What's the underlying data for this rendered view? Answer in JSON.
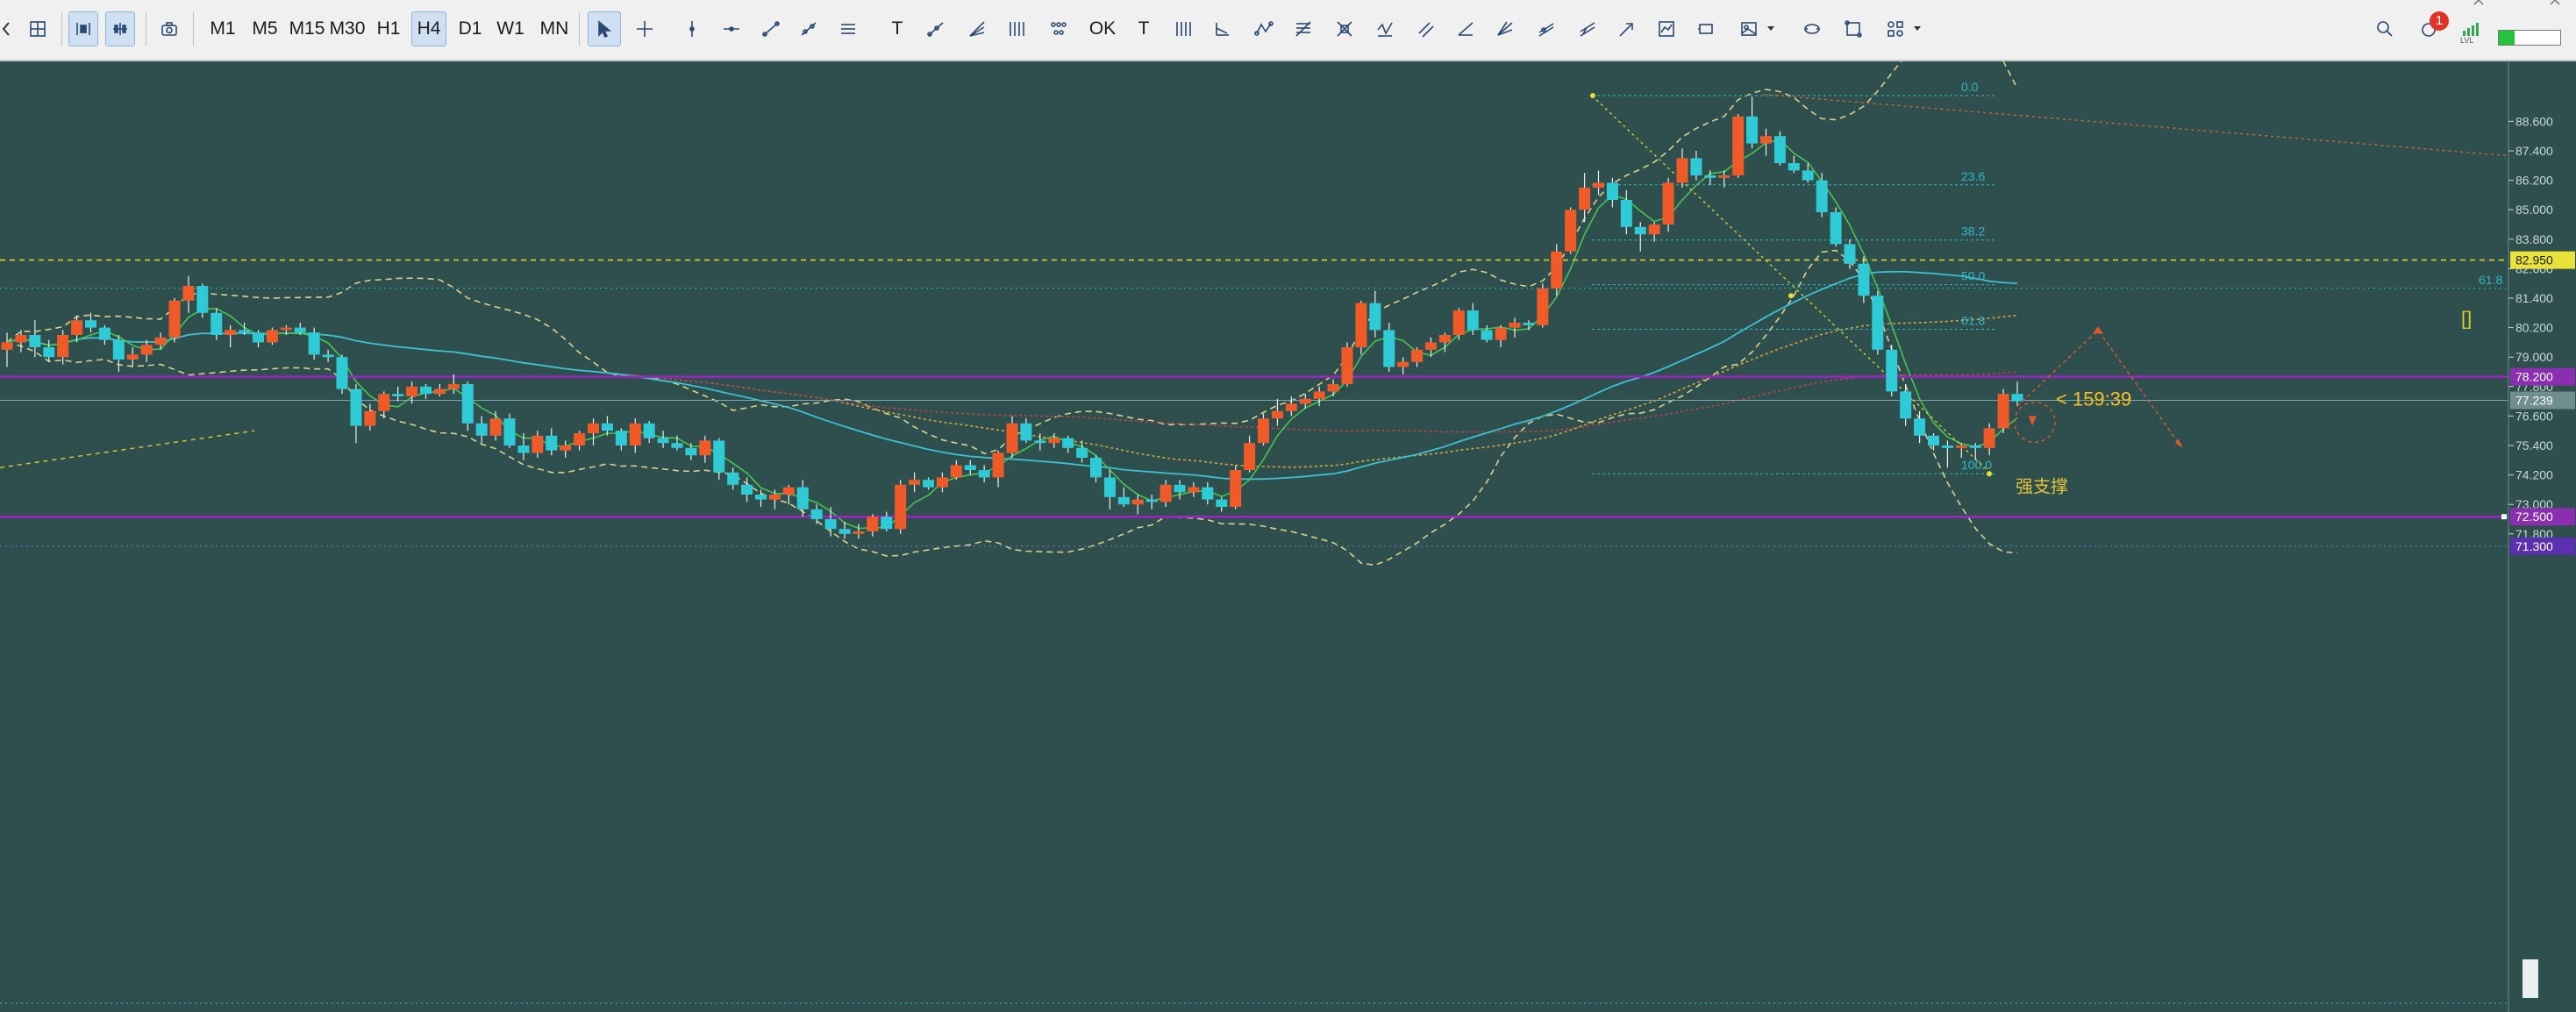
{
  "toolbar": {
    "timeframes": [
      "M1",
      "M5",
      "M15",
      "M30",
      "H1",
      "H4",
      "D1",
      "W1",
      "MN"
    ],
    "active_timeframe": "H4",
    "tool_text": {
      "text_tool": "T",
      "label_tool": "T",
      "ok_label": "OK"
    },
    "notification_count": "1",
    "level_label": "LVL"
  },
  "chart": {
    "countdown": "< 159:39",
    "support_label": "强支撑",
    "fib_levels": [
      "0.0",
      "23.6",
      "38.2",
      "50.0",
      "61.8",
      "100.0"
    ],
    "fib_extra": "61.8",
    "right_marker": "[]",
    "hlines": {
      "yellow": {
        "price": 82.95,
        "label": "82.950"
      },
      "purple_top": {
        "price": 78.2,
        "label": "78.200"
      },
      "current": {
        "price": 77.239,
        "label": "77.239"
      },
      "purple_bottom": {
        "price": 72.5,
        "label": "72.500"
      },
      "purple_low": {
        "price": 71.3,
        "label": "71.300"
      },
      "bottom_right": "50.0"
    },
    "colors": {
      "background": "#2f4f4f",
      "bull_candle": "#f05a28",
      "bear_candle": "#2ecbd6",
      "level_yellow": "#d8cf2a",
      "level_purple": "#a020c8",
      "fib": "#2fb7c3",
      "countdown": "#ffbf1f",
      "support": "#e2c13a"
    }
  },
  "chart_data": {
    "type": "candlestick",
    "title": "",
    "timeframe": "H4",
    "y_ticks": [
      88.6,
      87.4,
      86.2,
      85.0,
      83.8,
      82.6,
      81.4,
      80.2,
      79.0,
      77.8,
      76.6,
      75.4,
      74.2,
      73.0,
      71.8
    ],
    "y_tick_labels": [
      "88.600",
      "87.400",
      "86.200",
      "85.000",
      "83.800",
      "82.600",
      "81.400",
      "80.200",
      "79.000",
      "77.800",
      "76.600",
      "75.400",
      "74.200",
      "73.000",
      "71.800"
    ],
    "ylim": [
      70.7,
      89.9
    ],
    "candles": [
      [
        79.3,
        80.0,
        78.6,
        79.6
      ],
      [
        79.6,
        80.1,
        79.2,
        79.9
      ],
      [
        79.9,
        80.5,
        79.0,
        79.4
      ],
      [
        79.4,
        79.7,
        78.8,
        79.0
      ],
      [
        79.0,
        80.1,
        78.7,
        79.9
      ],
      [
        79.9,
        80.7,
        79.6,
        80.5
      ],
      [
        80.5,
        80.8,
        80.0,
        80.2
      ],
      [
        80.2,
        80.3,
        79.5,
        79.7
      ],
      [
        79.7,
        79.9,
        78.4,
        78.9
      ],
      [
        78.9,
        79.4,
        78.6,
        79.1
      ],
      [
        79.1,
        79.7,
        78.8,
        79.5
      ],
      [
        79.5,
        80.0,
        79.3,
        79.8
      ],
      [
        79.8,
        81.4,
        79.6,
        81.3
      ],
      [
        81.3,
        82.3,
        80.8,
        81.9
      ],
      [
        81.9,
        82.0,
        80.6,
        80.8
      ],
      [
        80.8,
        81.0,
        79.7,
        79.9
      ],
      [
        79.9,
        80.3,
        79.4,
        80.1
      ],
      [
        80.1,
        80.4,
        79.9,
        80.0
      ],
      [
        80.0,
        80.1,
        79.4,
        79.6
      ],
      [
        79.6,
        80.2,
        79.5,
        80.1
      ],
      [
        80.1,
        80.3,
        79.9,
        80.2
      ],
      [
        80.2,
        80.4,
        79.9,
        80.0
      ],
      [
        80.0,
        80.2,
        78.9,
        79.1
      ],
      [
        79.1,
        79.3,
        78.8,
        79.0
      ],
      [
        79.0,
        79.1,
        77.5,
        77.7
      ],
      [
        77.7,
        77.9,
        75.5,
        76.2
      ],
      [
        76.2,
        77.1,
        76.0,
        76.8
      ],
      [
        76.8,
        77.6,
        76.5,
        77.5
      ],
      [
        77.5,
        77.8,
        77.2,
        77.4
      ],
      [
        77.4,
        78.0,
        77.1,
        77.8
      ],
      [
        77.8,
        77.9,
        77.3,
        77.5
      ],
      [
        77.5,
        77.9,
        77.4,
        77.7
      ],
      [
        77.7,
        78.3,
        77.5,
        77.9
      ],
      [
        77.9,
        78.0,
        76.0,
        76.3
      ],
      [
        76.3,
        76.6,
        75.5,
        75.8
      ],
      [
        75.8,
        76.8,
        75.6,
        76.5
      ],
      [
        76.5,
        76.7,
        75.3,
        75.4
      ],
      [
        75.4,
        75.9,
        74.8,
        75.1
      ],
      [
        75.1,
        76.0,
        74.9,
        75.8
      ],
      [
        75.8,
        76.1,
        75.0,
        75.2
      ],
      [
        75.2,
        75.6,
        74.9,
        75.4
      ],
      [
        75.4,
        76.0,
        75.2,
        75.9
      ],
      [
        75.9,
        76.5,
        75.4,
        76.3
      ],
      [
        76.3,
        76.6,
        75.8,
        76.0
      ],
      [
        76.0,
        76.1,
        75.2,
        75.4
      ],
      [
        75.4,
        76.5,
        75.1,
        76.3
      ],
      [
        76.3,
        76.4,
        75.5,
        75.7
      ],
      [
        75.7,
        76.0,
        75.3,
        75.5
      ],
      [
        75.5,
        75.8,
        75.2,
        75.3
      ],
      [
        75.3,
        75.5,
        74.8,
        75.0
      ],
      [
        75.0,
        75.8,
        74.7,
        75.6
      ],
      [
        75.6,
        75.7,
        74.0,
        74.3
      ],
      [
        74.3,
        74.5,
        73.6,
        73.8
      ],
      [
        73.8,
        74.1,
        73.1,
        73.4
      ],
      [
        73.4,
        73.6,
        72.9,
        73.2
      ],
      [
        73.2,
        73.6,
        72.8,
        73.4
      ],
      [
        73.4,
        73.8,
        73.0,
        73.7
      ],
      [
        73.7,
        74.0,
        72.5,
        72.8
      ],
      [
        72.8,
        73.0,
        72.2,
        72.4
      ],
      [
        72.4,
        72.9,
        71.7,
        72.0
      ],
      [
        72.0,
        72.3,
        71.6,
        71.8
      ],
      [
        71.8,
        72.2,
        71.6,
        71.9
      ],
      [
        71.9,
        72.6,
        71.7,
        72.5
      ],
      [
        72.5,
        72.7,
        71.9,
        72.0
      ],
      [
        72.0,
        74.0,
        71.8,
        73.8
      ],
      [
        73.8,
        74.3,
        73.5,
        74.0
      ],
      [
        74.0,
        74.1,
        73.6,
        73.7
      ],
      [
        73.7,
        74.3,
        73.5,
        74.1
      ],
      [
        74.1,
        74.8,
        74.0,
        74.6
      ],
      [
        74.6,
        74.8,
        74.2,
        74.4
      ],
      [
        74.4,
        74.6,
        73.9,
        74.1
      ],
      [
        74.1,
        75.2,
        73.7,
        75.1
      ],
      [
        75.1,
        76.6,
        74.9,
        76.3
      ],
      [
        76.3,
        76.5,
        75.5,
        75.6
      ],
      [
        75.6,
        75.9,
        75.2,
        75.5
      ],
      [
        75.5,
        75.9,
        75.3,
        75.7
      ],
      [
        75.7,
        75.8,
        75.1,
        75.3
      ],
      [
        75.3,
        75.6,
        74.7,
        74.9
      ],
      [
        74.9,
        75.0,
        73.9,
        74.1
      ],
      [
        74.1,
        74.4,
        72.8,
        73.3
      ],
      [
        73.3,
        73.7,
        72.9,
        73.0
      ],
      [
        73.0,
        73.4,
        72.6,
        73.2
      ],
      [
        73.2,
        73.4,
        72.8,
        73.1
      ],
      [
        73.1,
        74.0,
        72.9,
        73.8
      ],
      [
        73.8,
        74.0,
        73.2,
        73.5
      ],
      [
        73.5,
        73.9,
        73.3,
        73.7
      ],
      [
        73.7,
        73.9,
        73.0,
        73.2
      ],
      [
        73.2,
        73.3,
        72.7,
        72.9
      ],
      [
        72.9,
        74.6,
        72.8,
        74.4
      ],
      [
        74.4,
        75.8,
        74.3,
        75.5
      ],
      [
        75.5,
        76.7,
        75.4,
        76.5
      ],
      [
        76.5,
        77.3,
        76.2,
        76.8
      ],
      [
        76.8,
        77.4,
        76.6,
        77.1
      ],
      [
        77.1,
        77.5,
        76.9,
        77.3
      ],
      [
        77.3,
        77.8,
        77.0,
        77.6
      ],
      [
        77.6,
        78.1,
        77.4,
        77.9
      ],
      [
        77.9,
        79.6,
        77.8,
        79.4
      ],
      [
        79.4,
        81.3,
        79.1,
        81.2
      ],
      [
        81.2,
        81.7,
        79.8,
        80.1
      ],
      [
        80.1,
        80.4,
        78.4,
        78.6
      ],
      [
        78.6,
        79.0,
        78.3,
        78.8
      ],
      [
        78.8,
        79.4,
        78.6,
        79.3
      ],
      [
        79.3,
        79.8,
        79.0,
        79.6
      ],
      [
        79.6,
        80.0,
        79.2,
        79.9
      ],
      [
        79.9,
        81.0,
        79.7,
        80.9
      ],
      [
        80.9,
        81.2,
        79.9,
        80.1
      ],
      [
        80.1,
        80.3,
        79.6,
        79.7
      ],
      [
        79.7,
        80.3,
        79.4,
        80.2
      ],
      [
        80.2,
        80.6,
        79.8,
        80.4
      ],
      [
        80.4,
        80.5,
        80.1,
        80.3
      ],
      [
        80.3,
        82.0,
        80.2,
        81.8
      ],
      [
        81.8,
        83.6,
        81.5,
        83.3
      ],
      [
        83.3,
        85.1,
        83.2,
        85.0
      ],
      [
        85.0,
        86.5,
        84.5,
        85.9
      ],
      [
        85.9,
        86.6,
        85.6,
        86.1
      ],
      [
        86.1,
        86.3,
        85.1,
        85.4
      ],
      [
        85.4,
        85.8,
        84.0,
        84.3
      ],
      [
        84.3,
        84.5,
        83.3,
        84.0
      ],
      [
        84.0,
        84.5,
        83.7,
        84.4
      ],
      [
        84.4,
        86.3,
        84.1,
        86.1
      ],
      [
        86.1,
        87.5,
        85.9,
        87.1
      ],
      [
        87.1,
        87.4,
        86.2,
        86.4
      ],
      [
        86.4,
        86.6,
        86.0,
        86.3
      ],
      [
        86.3,
        86.6,
        85.9,
        86.4
      ],
      [
        86.4,
        88.9,
        86.3,
        88.8
      ],
      [
        88.8,
        89.6,
        87.5,
        87.7
      ],
      [
        87.7,
        88.3,
        87.2,
        88.0
      ],
      [
        88.0,
        88.2,
        86.8,
        86.9
      ],
      [
        86.9,
        87.2,
        86.5,
        86.6
      ],
      [
        86.6,
        86.9,
        86.1,
        86.2
      ],
      [
        86.2,
        86.5,
        84.7,
        84.9
      ],
      [
        84.9,
        85.1,
        83.5,
        83.6
      ],
      [
        83.6,
        83.8,
        82.6,
        82.8
      ],
      [
        82.8,
        83.1,
        81.2,
        81.5
      ],
      [
        81.5,
        81.7,
        79.1,
        79.3
      ],
      [
        79.3,
        79.5,
        77.4,
        77.6
      ],
      [
        77.6,
        77.9,
        76.2,
        76.5
      ],
      [
        76.5,
        76.8,
        75.5,
        75.8
      ],
      [
        75.8,
        75.9,
        75.2,
        75.4
      ],
      [
        75.4,
        75.6,
        74.5,
        75.3
      ],
      [
        75.3,
        75.5,
        74.9,
        75.4
      ],
      [
        75.4,
        75.5,
        74.8,
        75.3
      ],
      [
        75.3,
        76.3,
        75.0,
        76.1
      ],
      [
        76.1,
        77.7,
        75.9,
        77.5
      ],
      [
        77.5,
        78.0,
        77.0,
        77.2
      ]
    ]
  }
}
